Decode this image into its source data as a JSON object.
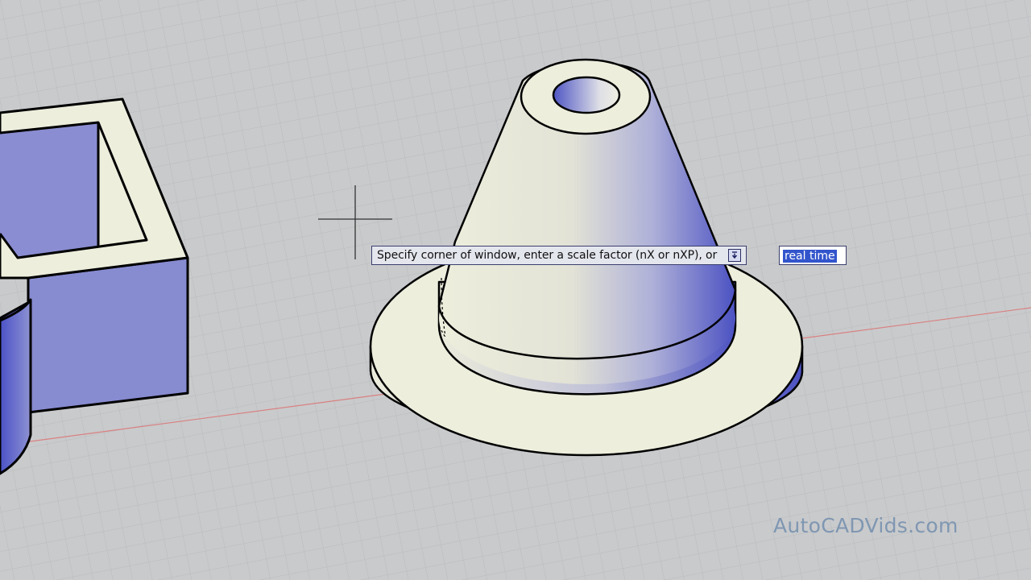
{
  "command_prompt": {
    "text": "Specify corner of window, enter a scale factor (nX or nXP), or",
    "options_icon": "down-arrow-options-icon",
    "input_value": "real time"
  },
  "watermark": "AutoCADVids.com",
  "colors": {
    "background": "#c9cacc",
    "grid": "#bdbec1",
    "solid_light": "#eeeedd",
    "solid_shade": "#6a6fc8",
    "x_axis": "#d98080"
  }
}
